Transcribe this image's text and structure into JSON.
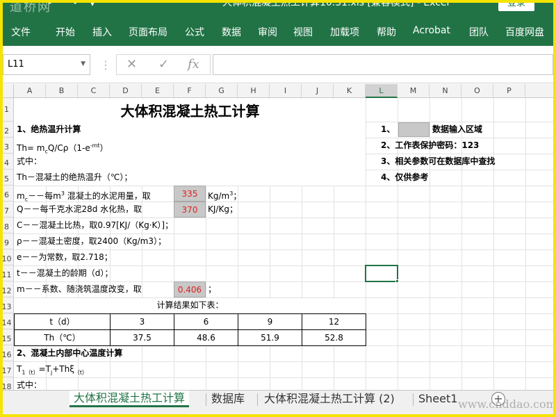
{
  "ribbon": {
    "watermark": "道桥网",
    "window_title": "大体积混凝土热工计算10.31.xls [兼容模式] - Excel",
    "login_label": "登录",
    "menu": [
      "文件",
      "开始",
      "插入",
      "页面布局",
      "公式",
      "数据",
      "审阅",
      "视图",
      "加载项",
      "帮助",
      "Acrobat",
      "团队",
      "百度网盘"
    ],
    "accent_color": "#217346"
  },
  "formula_bar": {
    "name_box": "L11",
    "cancel_icon": "✕",
    "enter_icon": "✓",
    "fx_label": "fx",
    "formula": ""
  },
  "columns": [
    "A",
    "B",
    "C",
    "D",
    "E",
    "F",
    "G",
    "H",
    "I",
    "J",
    "K",
    "L",
    "M",
    "N",
    "O",
    "P"
  ],
  "active_column": "L",
  "rows": [
    "1",
    "2",
    "3",
    "4",
    "5",
    "6",
    "7",
    "8",
    "9",
    "10",
    "11",
    "12",
    "13",
    "14",
    "15",
    "16",
    "17",
    "18"
  ],
  "sheet": {
    "title": "大体积混凝土热工计算",
    "section1": "1、绝热温升计算",
    "formula_text": "Th= m",
    "formula_sub": "c",
    "formula_rest": "Q/Cρ（1-e",
    "formula_sup": "-mt",
    "formula_end": "）",
    "where": "式中：",
    "th_desc": "Th－混凝土的绝热温升（℃）；",
    "mc_label": "m",
    "mc_sub": "c",
    "mc_desc": "－－每m",
    "mc_sup": "3",
    "mc_desc2": " 混凝土的水泥用量，取",
    "mc_value": "335",
    "mc_unit": "Kg/m",
    "mc_unit_sup": "3",
    "mc_unit_end": "；",
    "q_desc": "Q－－每千克水泥28d 水化热，取",
    "q_value": "370",
    "q_unit": "KJ/Kg；",
    "c_desc": "C－－混凝土比热，取0.97[KJ/（Kg·K）]；",
    "rho_desc": "ρ－－混凝土密度，取2400（Kg/m3）；",
    "e_desc": "e－－为常数，取2.718；",
    "t_desc": "t－－混凝土的龄期（d）；",
    "m_desc": "m－－系数、随浇筑温度改变，取",
    "m_value": "0.406",
    "m_unit": "；",
    "result_caption": "计算结果如下表：",
    "table_t_label": "t（d）",
    "table_t": [
      "3",
      "6",
      "9",
      "12"
    ],
    "table_th_label": "Th（℃）",
    "table_th": [
      "37.5",
      "48.6",
      "51.9",
      "52.8"
    ],
    "section2": "2、混凝土内部中心温度计算",
    "t1_a": "T",
    "t1_a_sub": "1（t）",
    "t1_b": "=T",
    "t1_b_sub": "j",
    "t1_c": "+Thξ",
    "t1_c_sub": "（t）",
    "where2": "式中："
  },
  "notes": {
    "n1_num": "1、",
    "n1_text": "数据输入区域",
    "n2": "2、工作表保护密码：123",
    "n3": "3、相关参数可在数据库中查找",
    "n4": "4、仅供参考"
  },
  "tabs": [
    "大体积混凝土热工计算",
    "数据库",
    "大体积混凝土热工计算 (2)",
    "Sheet1"
  ],
  "active_tab": "大体积混凝土热工计算",
  "footer_watermark": "www.cnddao.com"
}
